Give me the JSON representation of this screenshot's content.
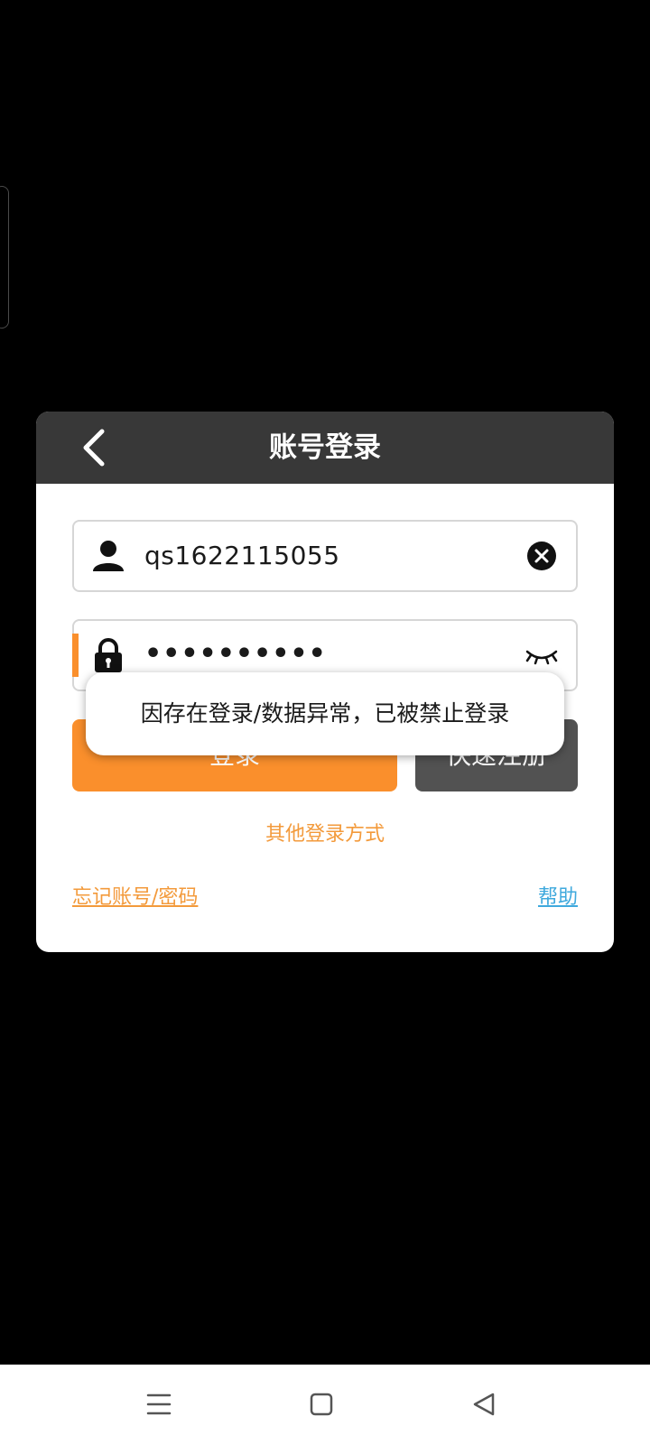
{
  "dialog": {
    "title": "账号登录",
    "back_icon": "chevron-left-icon"
  },
  "username": {
    "value": "qs1622115055",
    "icon": "user-icon",
    "clear_icon": "clear-circle-icon"
  },
  "password": {
    "value": "••••••••••",
    "icon": "lock-icon",
    "toggle_icon": "eye-closed-icon"
  },
  "buttons": {
    "login_label": "登录",
    "register_label": "快速注册"
  },
  "links": {
    "other_login": "其他登录方式",
    "forgot": "忘记账号/密码",
    "help": "帮助"
  },
  "toast": {
    "message": "因存在登录/数据异常，已被禁止登录"
  },
  "colors": {
    "accent": "#fa8f2c",
    "header": "#383838",
    "secondary_button": "#525252",
    "help_link": "#3fa9dd"
  },
  "nav": {
    "menu_icon": "menu-icon",
    "home_icon": "square-home-icon",
    "back_icon": "triangle-back-icon"
  }
}
